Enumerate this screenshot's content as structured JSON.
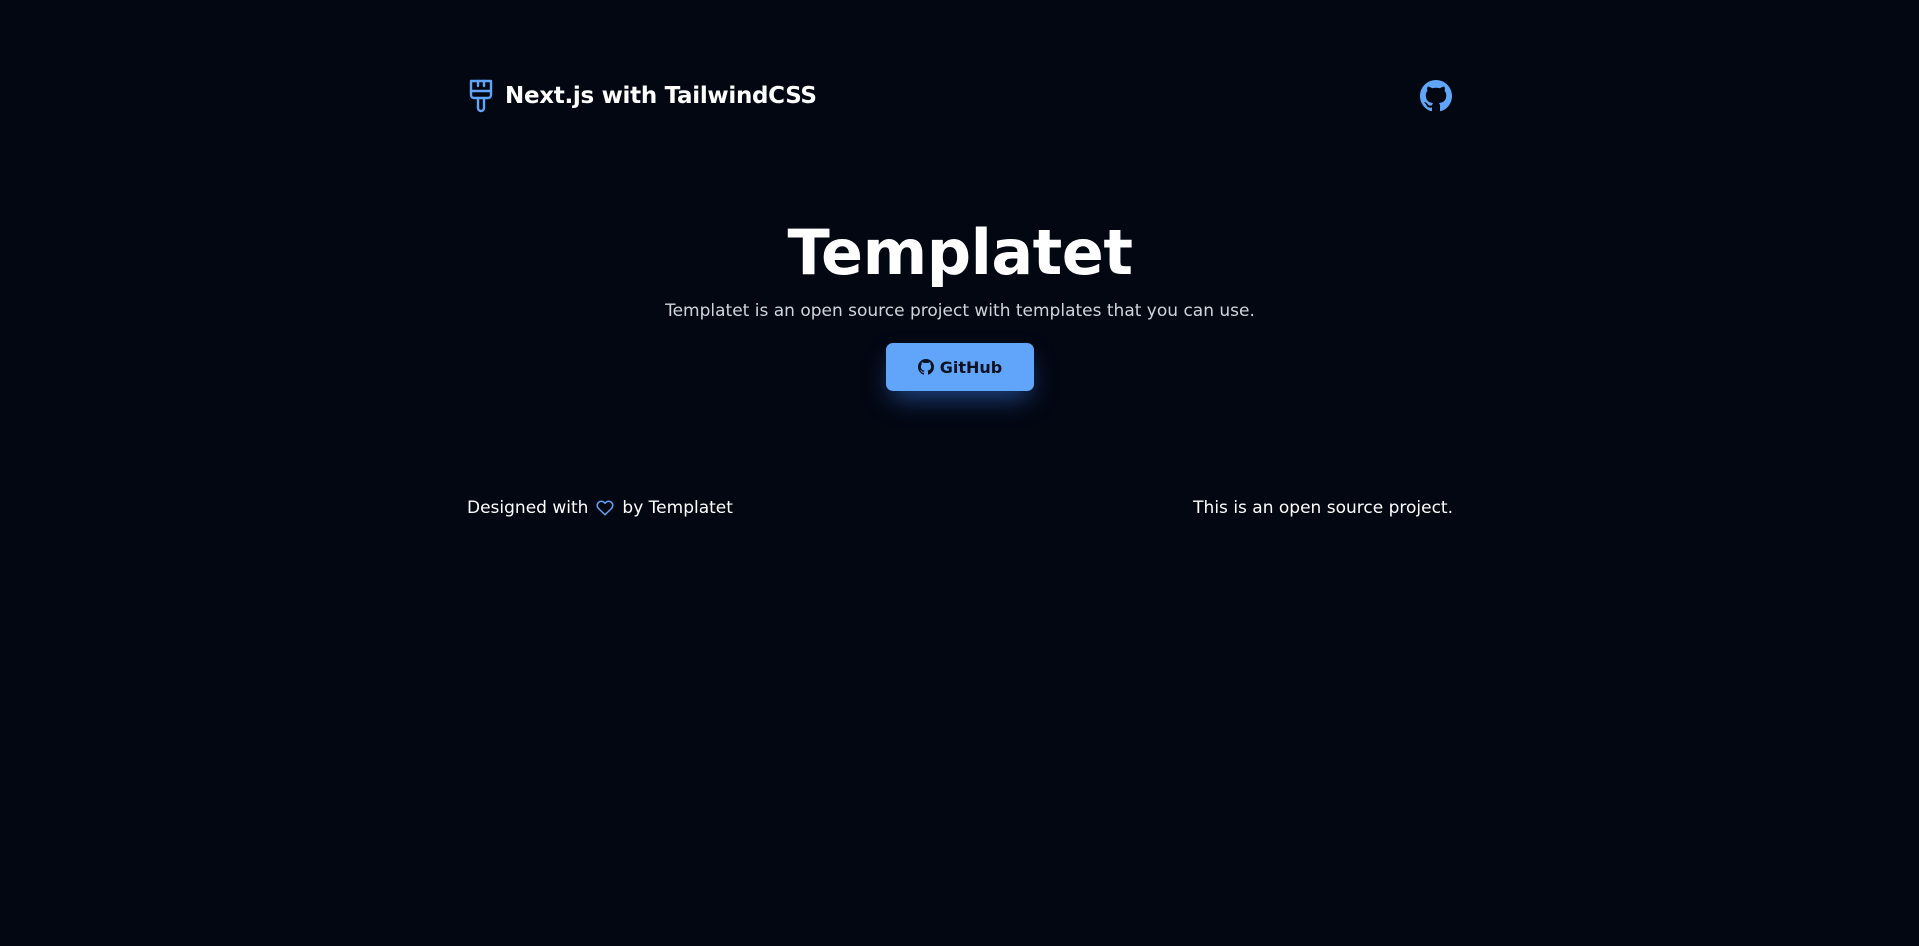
{
  "header": {
    "brand_text": "Next.js with TailwindCSS",
    "brand_icon": "paintbrush-icon",
    "github_icon": "github-icon"
  },
  "hero": {
    "title": "Templatet",
    "description": "Templatet is an open source project with templates that you can use.",
    "cta_label": "GitHub",
    "cta_icon": "github-icon"
  },
  "footer": {
    "left_prefix": "Designed with",
    "left_icon": "heart-icon",
    "left_suffix": "by Templatet",
    "right_text": "This is an open source project."
  },
  "colors": {
    "background": "#030712",
    "accent": "#60a5fa",
    "text": "#ffffff",
    "muted": "#d1d5db"
  }
}
